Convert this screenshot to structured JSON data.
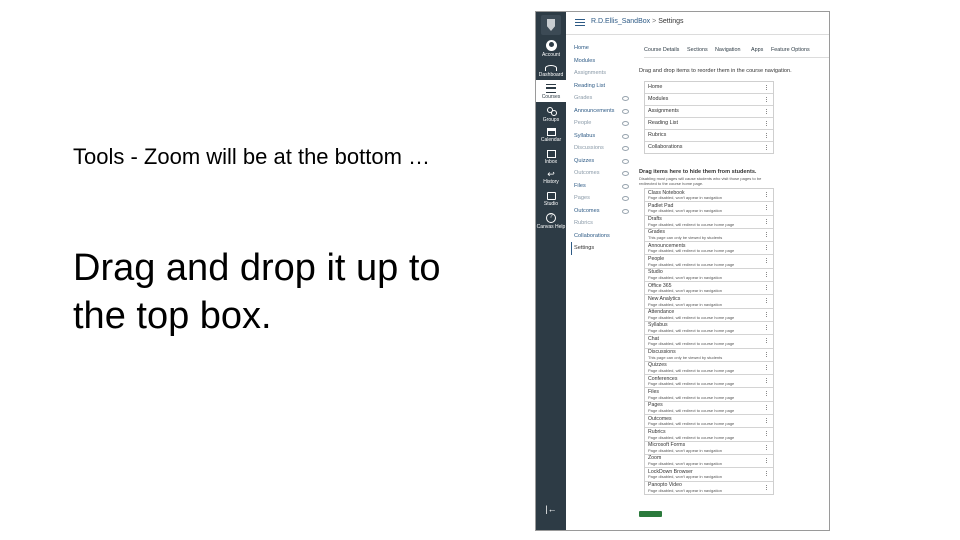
{
  "slide": {
    "note": "Tools - Zoom will be at the bottom …",
    "instruction": "Drag and drop it up to the top box."
  },
  "global_nav": {
    "items": [
      {
        "label": "Account",
        "icon": "account-avatar-icon"
      },
      {
        "label": "Dashboard",
        "icon": "dashboard-icon"
      },
      {
        "label": "Courses",
        "icon": "courses-icon"
      },
      {
        "label": "Groups",
        "icon": "groups-icon"
      },
      {
        "label": "Calendar",
        "icon": "calendar-icon"
      },
      {
        "label": "Inbox",
        "icon": "inbox-icon"
      },
      {
        "label": "History",
        "icon": "history-icon"
      },
      {
        "label": "Studio",
        "icon": "studio-icon"
      },
      {
        "label": "Canvas Help",
        "icon": "help-icon"
      }
    ],
    "active": "Courses",
    "colors": {
      "background": "#2d3b45",
      "text": "#ffffff"
    }
  },
  "header": {
    "course": "R.D.Ellis_SandBox",
    "separator": ">",
    "page": "Settings"
  },
  "course_nav": [
    {
      "label": "Home",
      "hidden": false
    },
    {
      "label": "Modules",
      "hidden": false
    },
    {
      "label": "Assignments",
      "hidden": true
    },
    {
      "label": "Reading List",
      "hidden": false
    },
    {
      "label": "Grades",
      "hidden": true
    },
    {
      "label": "Announcements",
      "hidden": false
    },
    {
      "label": "People",
      "hidden": true
    },
    {
      "label": "Syllabus",
      "hidden": true
    },
    {
      "label": "Discussions",
      "hidden": true
    },
    {
      "label": "Quizzes",
      "hidden": false
    },
    {
      "label": "Outcomes",
      "hidden": true
    },
    {
      "label": "Files",
      "hidden": true
    },
    {
      "label": "Pages",
      "hidden": true
    },
    {
      "label": "Outcomes",
      "hidden": false
    },
    {
      "label": "Rubrics",
      "hidden": true
    },
    {
      "label": "Collaborations",
      "hidden": false
    },
    {
      "label": "Settings",
      "hidden": false,
      "active": true
    }
  ],
  "tabs": [
    "Course Details",
    "Sections",
    "Navigation",
    "Apps",
    "Feature Options"
  ],
  "instructions": "Drag and drop items to reorder them in the course navigation.",
  "enabled_items": [
    "Home",
    "Modules",
    "Assignments",
    "Reading List",
    "Rubrics",
    "Collaborations"
  ],
  "disabled_section": {
    "title": "Drag items here to hide them from students.",
    "subtitle": "Disabling most pages will cause students who visit those pages to be redirected to the course home page."
  },
  "disabled_items": [
    {
      "name": "Class Notebook",
      "status": "Page disabled, won't appear in navigation"
    },
    {
      "name": "Padlet Pad",
      "status": "Page disabled, won't appear in navigation"
    },
    {
      "name": "Drafts",
      "status": "Page disabled, will redirect to course home page"
    },
    {
      "name": "Grades",
      "status": "This page can only be viewed by students"
    },
    {
      "name": "Announcements",
      "status": "Page disabled, will redirect to course home page"
    },
    {
      "name": "People",
      "status": "Page disabled, will redirect to course home page"
    },
    {
      "name": "Studio",
      "status": "Page disabled, won't appear in navigation"
    },
    {
      "name": "Office 365",
      "status": "Page disabled, won't appear in navigation"
    },
    {
      "name": "New Analytics",
      "status": "Page disabled, won't appear in navigation"
    },
    {
      "name": "Attendance",
      "status": "Page disabled, will redirect to course home page"
    },
    {
      "name": "Syllabus",
      "status": "Page disabled, will redirect to course home page"
    },
    {
      "name": "Chat",
      "status": "Page disabled, will redirect to course home page"
    },
    {
      "name": "Discussions",
      "status": "This page can only be viewed by students"
    },
    {
      "name": "Quizzes",
      "status": "Page disabled, will redirect to course home page"
    },
    {
      "name": "Conferences",
      "status": "Page disabled, will redirect to course home page"
    },
    {
      "name": "Files",
      "status": "Page disabled, will redirect to course home page"
    },
    {
      "name": "Pages",
      "status": "Page disabled, will redirect to course home page"
    },
    {
      "name": "Outcomes",
      "status": "Page disabled, will redirect to course home page"
    },
    {
      "name": "Rubrics",
      "status": "Page disabled, will redirect to course home page"
    },
    {
      "name": "Microsoft Forms",
      "status": "Page disabled, won't appear in navigation"
    },
    {
      "name": "Zoom",
      "status": "Page disabled, won't appear in navigation"
    },
    {
      "name": "LockDown Browser",
      "status": "Page disabled, won't appear in navigation"
    },
    {
      "name": "Panopto Video",
      "status": "Page disabled, won't appear in navigation"
    }
  ],
  "save_button": "Save",
  "colors": {
    "link": "#2d5a85",
    "save": "#2b7a3c"
  }
}
